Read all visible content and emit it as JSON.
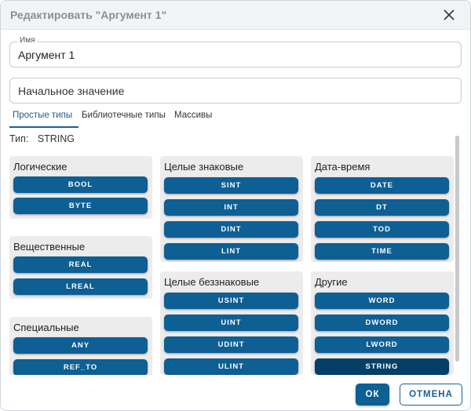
{
  "dialog": {
    "title": "Редактировать \"Аргумент 1\"",
    "close_icon": "close-icon"
  },
  "name_field": {
    "legend": "Имя",
    "value": "Аргумент 1"
  },
  "initial_value_field": {
    "placeholder": "Начальное значение",
    "value": ""
  },
  "tabs": [
    {
      "label": "Простые типы",
      "active": true
    },
    {
      "label": "Библиотечные типы",
      "active": false
    },
    {
      "label": "Массивы",
      "active": false
    }
  ],
  "type_line": {
    "label": "Тип:",
    "value": "STRING"
  },
  "groups": {
    "logical": {
      "title": "Логические",
      "items": [
        "BOOL",
        "BYTE"
      ]
    },
    "real": {
      "title": "Вещественные",
      "items": [
        "REAL",
        "LREAL"
      ]
    },
    "special": {
      "title": "Специальные",
      "items": [
        "ANY",
        "REF_TO"
      ]
    },
    "signed": {
      "title": "Целые знаковые",
      "items": [
        "SINT",
        "INT",
        "DINT",
        "LINT"
      ]
    },
    "unsigned": {
      "title": "Целые беззнаковые",
      "items": [
        "USINT",
        "UINT",
        "UDINT",
        "ULINT"
      ]
    },
    "datetime": {
      "title": "Дата-время",
      "items": [
        "DATE",
        "DT",
        "TOD",
        "TIME"
      ]
    },
    "other": {
      "title": "Другие",
      "items": [
        "WORD",
        "DWORD",
        "LWORD",
        "STRING"
      ]
    }
  },
  "selected_type": "STRING",
  "footer": {
    "ok_label": "ОК",
    "cancel_label": "ОТМЕНА"
  },
  "colors": {
    "accent": "#0d5f94",
    "accent_selected": "#033f66",
    "group_bg": "#ececec"
  }
}
